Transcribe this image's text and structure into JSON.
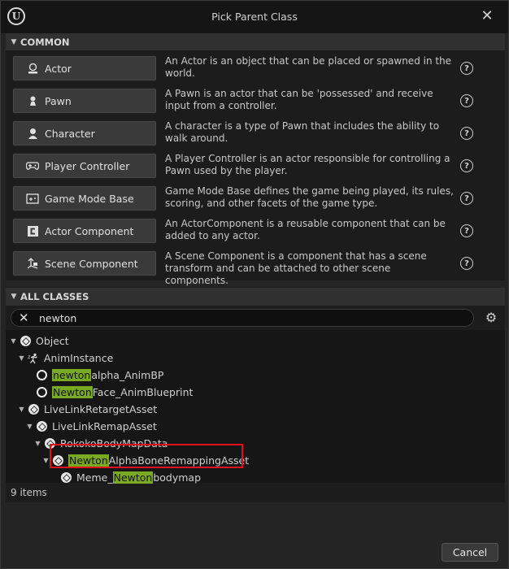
{
  "window": {
    "title": "Pick Parent Class"
  },
  "common": {
    "header": "COMMON",
    "items": [
      {
        "label": "Actor",
        "icon": "actor-icon",
        "desc": "An Actor is an object that can be placed or spawned in the world."
      },
      {
        "label": "Pawn",
        "icon": "pawn-icon",
        "desc": "A Pawn is an actor that can be 'possessed' and receive input from a controller."
      },
      {
        "label": "Character",
        "icon": "character-icon",
        "desc": "A character is a type of Pawn that includes the ability to walk around."
      },
      {
        "label": "Player Controller",
        "icon": "gamepad-icon",
        "desc": "A Player Controller is an actor responsible for controlling a Pawn used by the player."
      },
      {
        "label": "Game Mode Base",
        "icon": "game-mode-icon",
        "desc": "Game Mode Base defines the game being played, its rules, scoring, and other facets of the game type."
      },
      {
        "label": "Actor Component",
        "icon": "actor-component-icon",
        "desc": "An ActorComponent is a reusable component that can be added to any actor."
      },
      {
        "label": "Scene Component",
        "icon": "scene-component-icon",
        "desc": "A Scene Component is a component that has a scene transform and can be attached to other scene components."
      }
    ]
  },
  "all_classes": {
    "header": "ALL CLASSES",
    "search": {
      "value": "newton"
    },
    "tree": [
      {
        "pre": "",
        "hl": "",
        "post": "Object",
        "icon": "cube"
      },
      {
        "pre": "",
        "hl": "",
        "post": "AnimInstance",
        "icon": "anim"
      },
      {
        "pre": "",
        "hl": "newton",
        "post": "alpha_AnimBP",
        "icon": "ring"
      },
      {
        "pre": "",
        "hl": "Newton",
        "post": "Face_AnimBlueprint",
        "icon": "ring"
      },
      {
        "pre": "",
        "hl": "",
        "post": "LiveLinkRetargetAsset",
        "icon": "cube"
      },
      {
        "pre": "",
        "hl": "",
        "post": "LiveLinkRemapAsset",
        "icon": "cube"
      },
      {
        "pre": "",
        "hl": "",
        "post": "RokokoBodyMapData",
        "icon": "cube"
      },
      {
        "pre": "",
        "hl": "Newton",
        "post": "AlphaBoneRemappingAsset",
        "icon": "cube"
      },
      {
        "pre": "Meme_",
        "hl": "Newton",
        "post": "bodymap",
        "icon": "cube"
      }
    ],
    "status": "9 items"
  },
  "footer": {
    "cancel": "Cancel"
  },
  "colors": {
    "highlight": "#7aaa22",
    "selection_box": "#e0101a"
  }
}
